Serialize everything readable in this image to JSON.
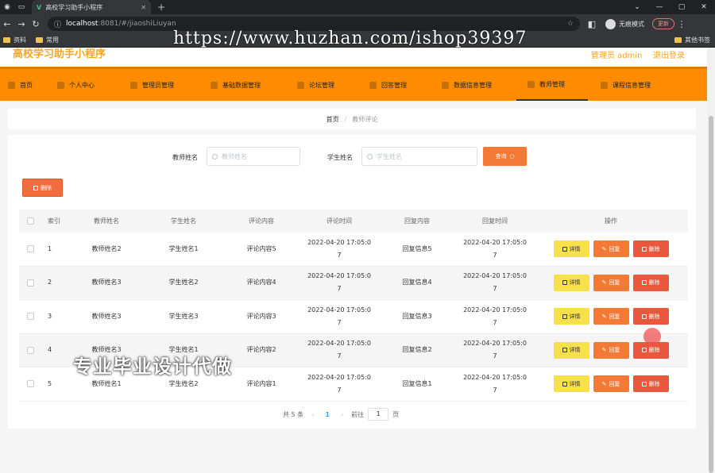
{
  "browser": {
    "tab_title": "高校学习助手小程序",
    "url_host": "localhost",
    "url_path": ":8081/#/jiaoshiLiuyan",
    "profile_label": "无痕模式",
    "update_label": "更新",
    "bookmarks": [
      "资料",
      "常用"
    ],
    "other_bookmarks": "其他书签"
  },
  "watermark_url": "https://www.huzhan.com/ishop39397",
  "app": {
    "title": "高校学习助手小程序",
    "admin_label": "管理员 admin",
    "logout_label": "退出登录"
  },
  "menu": [
    {
      "label": "首页"
    },
    {
      "label": "个人中心"
    },
    {
      "label": "管理员管理"
    },
    {
      "label": "基础数据管理"
    },
    {
      "label": "论坛管理"
    },
    {
      "label": "回答管理"
    },
    {
      "label": "数据信息管理"
    },
    {
      "label": "教师管理"
    },
    {
      "label": "课程信息管理"
    }
  ],
  "breadcrumb": {
    "home": "首页",
    "sep": "/",
    "current": "教师评论"
  },
  "search": {
    "teacher_label": "教师姓名",
    "teacher_placeholder": "教师姓名",
    "student_label": "学生姓名",
    "student_placeholder": "学生姓名",
    "button": "查询"
  },
  "delete_button": "删除",
  "table": {
    "headers": [
      "索引",
      "教师姓名",
      "学生姓名",
      "评论内容",
      "评论时间",
      "回复内容",
      "回复时间",
      "操作"
    ],
    "rows": [
      {
        "index": "1",
        "teacher": "教师姓名2",
        "student": "学生姓名1",
        "content": "评论内容5",
        "time_a": "2022-04-20 17:05:0",
        "time_b": "7",
        "reply": "回复信息5",
        "rtime_a": "2022-04-20 17:05:0",
        "rtime_b": "7"
      },
      {
        "index": "2",
        "teacher": "教师姓名3",
        "student": "学生姓名2",
        "content": "评论内容4",
        "time_a": "2022-04-20 17:05:0",
        "time_b": "7",
        "reply": "回复信息4",
        "rtime_a": "2022-04-20 17:05:0",
        "rtime_b": "7"
      },
      {
        "index": "3",
        "teacher": "教师姓名3",
        "student": "学生姓名3",
        "content": "评论内容3",
        "time_a": "2022-04-20 17:05:0",
        "time_b": "7",
        "reply": "回复信息3",
        "rtime_a": "2022-04-20 17:05:0",
        "rtime_b": "7"
      },
      {
        "index": "4",
        "teacher": "教师姓名3",
        "student": "学生姓名1",
        "content": "评论内容2",
        "time_a": "2022-04-20 17:05:0",
        "time_b": "7",
        "reply": "回复信息2",
        "rtime_a": "2022-04-20 17:05:0",
        "rtime_b": "7"
      },
      {
        "index": "5",
        "teacher": "教师姓名1",
        "student": "学生姓名2",
        "content": "评论内容1",
        "time_a": "2022-04-20 17:05:0",
        "time_b": "7",
        "reply": "回复信息1",
        "rtime_a": "2022-04-20 17:05:0",
        "rtime_b": "7"
      }
    ],
    "actions": {
      "detail": "详情",
      "reply": "回复",
      "delete": "删除"
    }
  },
  "pager": {
    "total": "共 5 条",
    "prev": "‹",
    "current_page": "1",
    "next": "›",
    "goto": "前往",
    "goto_value": "1",
    "page_unit": "页"
  },
  "overlay_text": "专业毕业设计代做"
}
